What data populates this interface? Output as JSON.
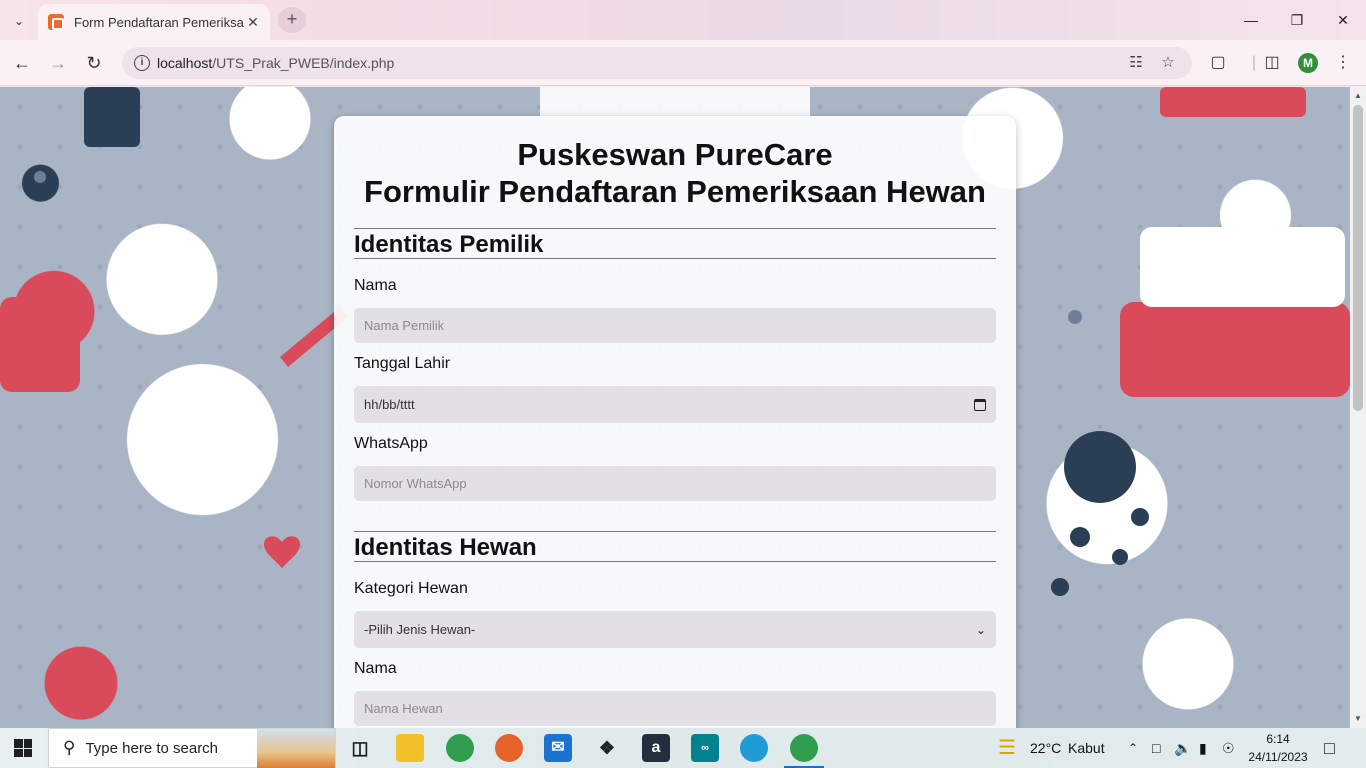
{
  "browser": {
    "tab_title": "Form Pendaftaran Pemeriksaan",
    "url_host": "localhost",
    "url_path": "/UTS_Prak_PWEB/index.php",
    "profile_initial": "M"
  },
  "form": {
    "title_line1": "Puskeswan PureCare",
    "title_line2": "Formulir Pendaftaran Pemeriksaan Hewan",
    "owner_section": {
      "heading": "Identitas Pemilik",
      "name_label": "Nama",
      "name_placeholder": "Nama Pemilik",
      "dob_label": "Tanggal Lahir",
      "dob_value": "hh/bb/tttt",
      "whatsapp_label": "WhatsApp",
      "whatsapp_placeholder": "Nomor WhatsApp"
    },
    "pet_section": {
      "heading": "Identitas Hewan",
      "category_label": "Kategori Hewan",
      "category_selected": "-Pilih Jenis Hewan-",
      "name_label": "Nama",
      "name_placeholder": "Nama Hewan"
    }
  },
  "taskbar": {
    "search_placeholder": "Type here to search",
    "weather_temp": "22°C",
    "weather_desc": "Kabut",
    "time": "6:14",
    "date": "24/11/2023"
  },
  "colors": {
    "page_background": "#a9b5c4",
    "card_background": "#ffffff",
    "input_background": "#e2e0e3",
    "chrome_background": "#fbf1f4",
    "favicon": "#f0692e",
    "profile_avatar": "#2f8f3a"
  }
}
